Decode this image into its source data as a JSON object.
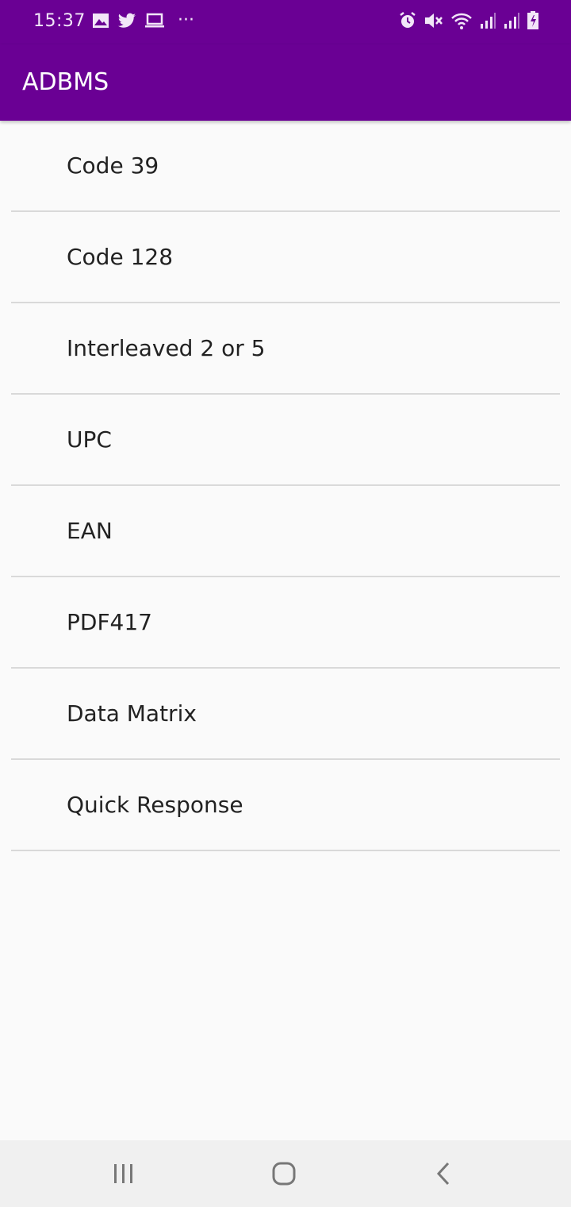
{
  "status_bar": {
    "time": "15:37",
    "left_icons": [
      "gallery-icon",
      "twitter-icon",
      "laptop-icon",
      "more-dots-icon"
    ],
    "right_icons": [
      "alarm-icon",
      "mute-icon",
      "wifi-icon",
      "signal-icon",
      "signal-icon",
      "battery-charging-icon"
    ],
    "more_glyph": "···"
  },
  "app_bar": {
    "title": "ADBMS",
    "color": "#6a0094"
  },
  "list": {
    "items": [
      {
        "label": "Code 39"
      },
      {
        "label": "Code 128"
      },
      {
        "label": "Interleaved 2 or 5"
      },
      {
        "label": "UPC"
      },
      {
        "label": "EAN"
      },
      {
        "label": "PDF417"
      },
      {
        "label": "Data Matrix"
      },
      {
        "label": "Quick Response"
      }
    ]
  },
  "nav_bar": {
    "buttons": [
      "recent-apps-icon",
      "home-icon",
      "back-icon"
    ]
  }
}
